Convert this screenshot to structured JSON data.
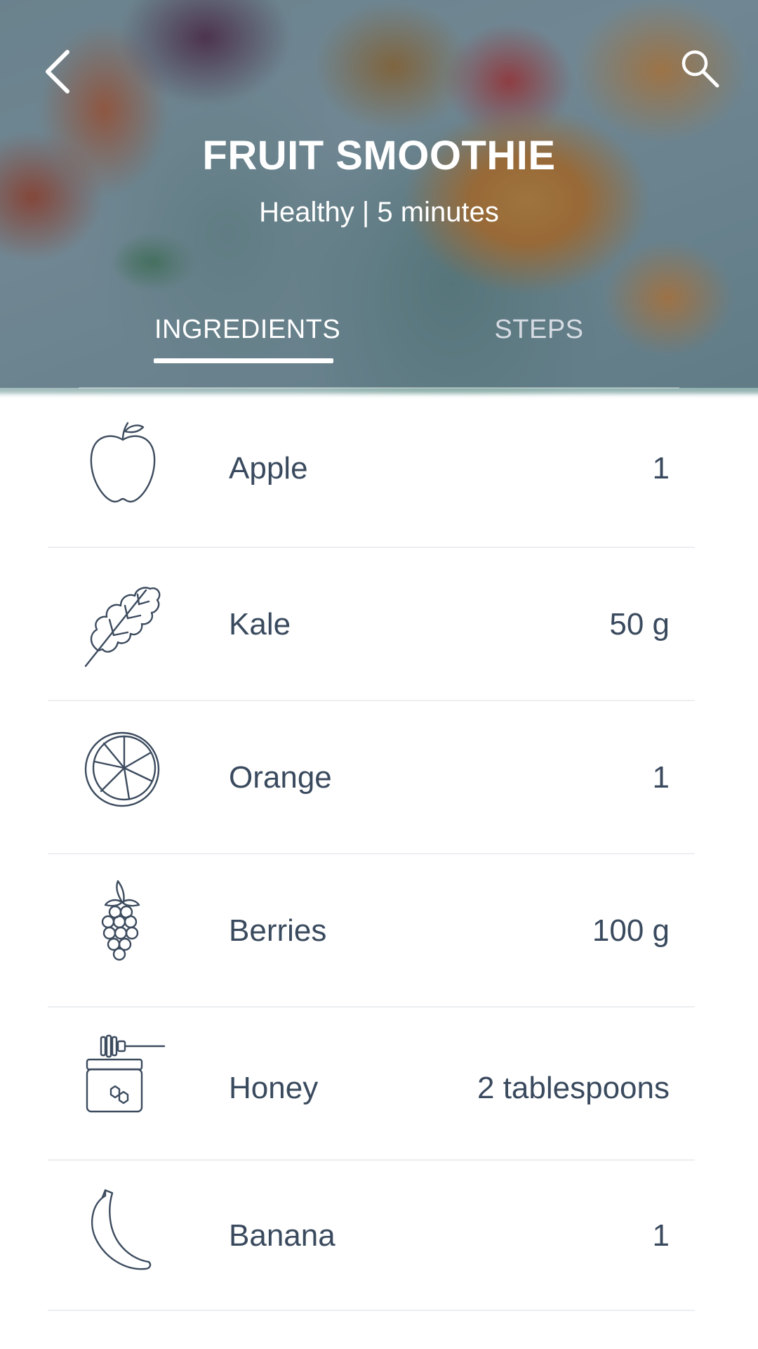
{
  "header": {
    "title": "FRUIT SMOOTHIE",
    "subtitle": "Healthy | 5 minutes",
    "back_icon": "chevron-left-icon",
    "search_icon": "search-icon"
  },
  "tabs": [
    {
      "label": "INGREDIENTS",
      "active": true
    },
    {
      "label": "STEPS",
      "active": false
    }
  ],
  "ingredients": [
    {
      "name": "Apple",
      "quantity": "1",
      "icon": "apple-icon"
    },
    {
      "name": "Kale",
      "quantity": "50 g",
      "icon": "kale-leaf-icon"
    },
    {
      "name": "Orange",
      "quantity": "1",
      "icon": "orange-slice-icon"
    },
    {
      "name": "Berries",
      "quantity": "100 g",
      "icon": "raspberry-icon"
    },
    {
      "name": "Honey",
      "quantity": "2 tablespoons",
      "icon": "honey-jar-icon"
    },
    {
      "name": "Banana",
      "quantity": "1",
      "icon": "banana-icon"
    }
  ],
  "colors": {
    "text_dark": "#3a4a5e",
    "divider": "#eceef1",
    "tab_active": "#ffffff",
    "tab_inactive": "#d6dbe3"
  }
}
